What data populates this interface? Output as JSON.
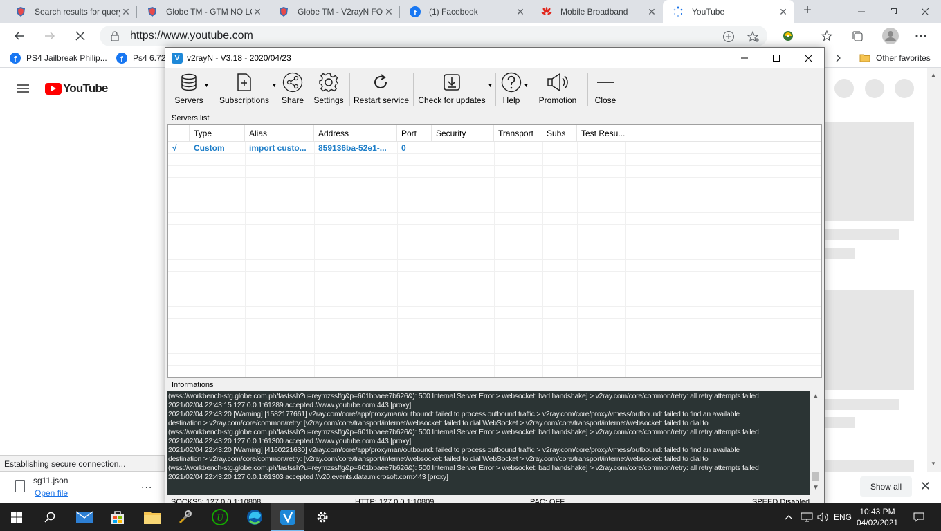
{
  "browser": {
    "tabs": [
      {
        "title": "Search results for query"
      },
      {
        "title": "Globe TM - GTM NO LO"
      },
      {
        "title": "Globe TM - V2rayN FO"
      },
      {
        "title": "(1) Facebook"
      },
      {
        "title": "Mobile Broadband"
      },
      {
        "title": "YouTube"
      }
    ],
    "url": "https://www.youtube.com",
    "favorites": [
      {
        "label": "PS4 Jailbreak Philip..."
      },
      {
        "label": "Ps4 6.72/"
      }
    ],
    "other_favorites": "Other favorites",
    "status_text": "Establishing secure connection...",
    "download": {
      "file_name": "sg11.json",
      "open_label": "Open file",
      "more": "...",
      "show_all": "Show all"
    },
    "page": {
      "logo_text": "YouTube"
    }
  },
  "v2rayn": {
    "title": "v2rayN - V3.18 - 2020/04/23",
    "toolbar": [
      {
        "label": "Servers",
        "icon": "database-icon"
      },
      {
        "label": "Subscriptions",
        "icon": "subscription-icon"
      },
      {
        "label": "Share",
        "icon": "share-icon"
      },
      {
        "label": "Settings",
        "icon": "gear-icon"
      },
      {
        "label": "Restart service",
        "icon": "restart-icon"
      },
      {
        "label": "Check for updates",
        "icon": "download-icon"
      },
      {
        "label": "Help",
        "icon": "help-icon"
      },
      {
        "label": "Promotion",
        "icon": "speaker-icon"
      },
      {
        "label": "Close",
        "icon": "close-icon"
      }
    ],
    "servers_label": "Servers list",
    "columns": [
      "Type",
      "Alias",
      "Address",
      "Port",
      "Security",
      "Transport",
      "Subs",
      "Test Resu..."
    ],
    "rows": [
      {
        "active": "√",
        "type": "Custom",
        "alias": "import custo...",
        "address": "859136ba-52e1-...",
        "port": "0",
        "security": "",
        "transport": "",
        "subs": "",
        "test": ""
      }
    ],
    "info_label": "Informations",
    "log": [
      "(wss://workbench-stg.globe.com.ph/fastssh?u=reymzssffg&p=601bbaee7b626&): 500 Internal Server Error > websocket: bad handshake] > v2ray.com/core/common/retry: all retry attempts failed",
      "2021/02/04 22:43:15 127.0.0.1:61289 accepted //www.youtube.com:443 [proxy]",
      "2021/02/04 22:43:20 [Warning] [1582177661] v2ray.com/core/app/proxyman/outbound: failed to process outbound traffic > v2ray.com/core/proxy/vmess/outbound: failed to find an available",
      "destination > v2ray.com/core/common/retry: [v2ray.com/core/transport/internet/websocket: failed to dial WebSocket > v2ray.com/core/transport/internet/websocket: failed to dial to",
      "(wss://workbench-stg.globe.com.ph/fastssh?u=reymzssffg&p=601bbaee7b626&): 500 Internal Server Error > websocket: bad handshake] > v2ray.com/core/common/retry: all retry attempts failed",
      "2021/02/04 22:43:20 127.0.0.1:61300 accepted //www.youtube.com:443 [proxy]",
      "2021/02/04 22:43:20 [Warning] [4160221630] v2ray.com/core/app/proxyman/outbound: failed to process outbound traffic > v2ray.com/core/proxy/vmess/outbound: failed to find an available",
      "destination > v2ray.com/core/common/retry: [v2ray.com/core/transport/internet/websocket: failed to dial WebSocket > v2ray.com/core/transport/internet/websocket: failed to dial to",
      "(wss://workbench-stg.globe.com.ph/fastssh?u=reymzssffg&p=601bbaee7b626&): 500 Internal Server Error > websocket: bad handshake] > v2ray.com/core/common/retry: all retry attempts failed",
      "2021/02/04 22:43:20 127.0.0.1:61303 accepted //v20.events.data.microsoft.com:443 [proxy]"
    ],
    "status": {
      "socks": "SOCKS5:  127.0.0.1:10808",
      "http": "HTTP:  127.0.0.1:10809",
      "pac": "PAC:  OFF",
      "speed": "SPEED Disabled"
    }
  },
  "taskbar": {
    "language": "ENG",
    "time": "10:43 PM",
    "date": "04/02/2021"
  },
  "colors": {
    "accent": "#1e7ec8",
    "log_bg": "#2b3434",
    "youtube_red": "#ff0000",
    "taskbar": "#1f1f1f"
  }
}
